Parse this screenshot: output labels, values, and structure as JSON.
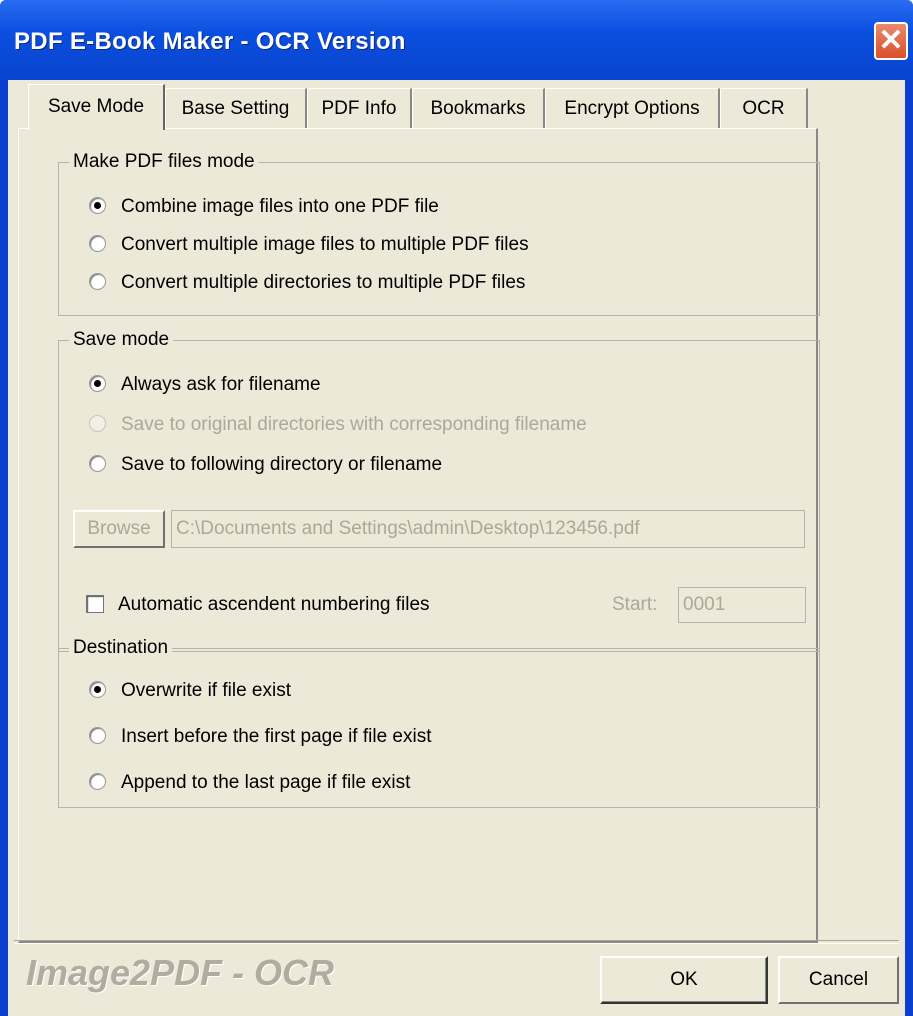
{
  "window": {
    "title": "PDF E-Book Maker - OCR Version",
    "close_glyph": "✕"
  },
  "tabs": [
    {
      "label": "Save Mode",
      "active": true
    },
    {
      "label": "Base Setting",
      "active": false
    },
    {
      "label": "PDF Info",
      "active": false
    },
    {
      "label": "Bookmarks",
      "active": false
    },
    {
      "label": "Encrypt Options",
      "active": false
    },
    {
      "label": "OCR",
      "active": false
    }
  ],
  "make_pdf_mode": {
    "legend": "Make PDF files mode",
    "options": [
      {
        "label": "Combine image files into one PDF file",
        "checked": true,
        "enabled": true
      },
      {
        "label": "Convert multiple image files to multiple PDF files",
        "checked": false,
        "enabled": true
      },
      {
        "label": "Convert multiple directories to multiple PDF files",
        "checked": false,
        "enabled": true
      }
    ]
  },
  "save_mode": {
    "legend": "Save mode",
    "options": [
      {
        "label": "Always ask for filename",
        "checked": true,
        "enabled": true
      },
      {
        "label": "Save to original directories with corresponding filename",
        "checked": false,
        "enabled": false
      },
      {
        "label": "Save to following directory or filename",
        "checked": false,
        "enabled": true
      }
    ],
    "browse_label": "Browse",
    "path_value": "C:\\Documents and Settings\\admin\\Desktop\\123456.pdf"
  },
  "numbering": {
    "label": "Automatic ascendent numbering files",
    "checked": false,
    "start_label": "Start:",
    "start_value": "0001"
  },
  "destination": {
    "legend": "Destination",
    "options": [
      {
        "label": "Overwrite if file exist",
        "checked": true,
        "enabled": true
      },
      {
        "label": "Insert before the first page if file exist",
        "checked": false,
        "enabled": true
      },
      {
        "label": "Append to the last page if file exist",
        "checked": false,
        "enabled": true
      }
    ]
  },
  "footer": {
    "brand": "Image2PDF - OCR",
    "ok_label": "OK",
    "cancel_label": "Cancel"
  },
  "colors": {
    "titlebar": "#0a4fe0",
    "dialog_bg": "#ece9d8",
    "disabled_text": "#aca899",
    "close_button": "#d8502a"
  }
}
